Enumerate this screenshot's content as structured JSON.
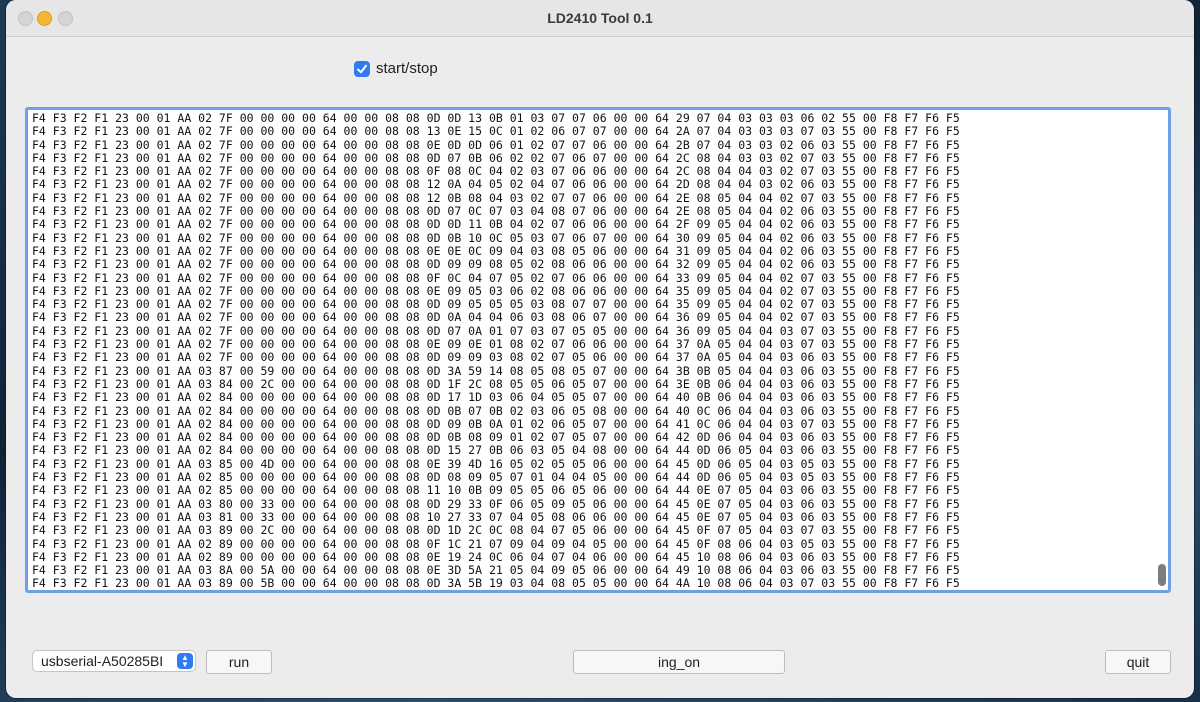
{
  "window": {
    "title": "LD2410 Tool 0.1"
  },
  "controls": {
    "start_stop_label": "start/stop",
    "start_stop_checked": true,
    "port_value": "usbserial-A50285BI",
    "run_label": "run",
    "ing_label": "ing_on",
    "quit_label": "quit"
  },
  "log_lines": [
    "F4 F3 F2 F1 23 00 01 AA 02 7F 00 00 00 00 64 00 00 08 08 0D 0D 13 0B 01 03 07 07 06 00 00 64 29 07 04 03 03 03 06 02 55 00 F8 F7 F6 F5",
    "F4 F3 F2 F1 23 00 01 AA 02 7F 00 00 00 00 64 00 00 08 08 13 0E 15 0C 01 02 06 07 07 00 00 64 2A 07 04 03 03 03 07 03 55 00 F8 F7 F6 F5",
    "F4 F3 F2 F1 23 00 01 AA 02 7F 00 00 00 00 64 00 00 08 08 0E 0D 0D 06 01 02 07 07 06 00 00 64 2B 07 04 03 03 02 06 03 55 00 F8 F7 F6 F5",
    "F4 F3 F2 F1 23 00 01 AA 02 7F 00 00 00 00 64 00 00 08 08 0D 07 0B 06 02 02 07 06 07 00 00 64 2C 08 04 03 03 02 07 03 55 00 F8 F7 F6 F5",
    "F4 F3 F2 F1 23 00 01 AA 02 7F 00 00 00 00 64 00 00 08 08 0F 08 0C 04 02 03 07 06 06 00 00 64 2C 08 04 04 03 02 07 03 55 00 F8 F7 F6 F5",
    "F4 F3 F2 F1 23 00 01 AA 02 7F 00 00 00 00 64 00 00 08 08 12 0A 04 05 02 04 07 06 06 00 00 64 2D 08 04 04 03 02 06 03 55 00 F8 F7 F6 F5",
    "F4 F3 F2 F1 23 00 01 AA 02 7F 00 00 00 00 64 00 00 08 08 12 0B 08 04 03 02 07 07 06 00 00 64 2E 08 05 04 04 02 07 03 55 00 F8 F7 F6 F5",
    "F4 F3 F2 F1 23 00 01 AA 02 7F 00 00 00 00 64 00 00 08 08 0D 07 0C 07 03 04 08 07 06 00 00 64 2E 08 05 04 04 02 06 03 55 00 F8 F7 F6 F5",
    "F4 F3 F2 F1 23 00 01 AA 02 7F 00 00 00 00 64 00 00 08 08 0D 0D 11 0B 04 02 07 06 06 00 00 64 2F 09 05 04 04 02 06 03 55 00 F8 F7 F6 F5",
    "F4 F3 F2 F1 23 00 01 AA 02 7F 00 00 00 00 64 00 00 08 08 0D 0B 10 0C 05 03 07 06 07 00 00 64 30 09 05 04 04 02 06 03 55 00 F8 F7 F6 F5",
    "F4 F3 F2 F1 23 00 01 AA 02 7F 00 00 00 00 64 00 00 08 08 0E 0E 0C 09 04 03 08 05 06 00 00 64 31 09 05 04 04 02 06 03 55 00 F8 F7 F6 F5",
    "F4 F3 F2 F1 23 00 01 AA 02 7F 00 00 00 00 64 00 00 08 08 0D 09 09 08 05 02 08 06 06 00 00 64 32 09 05 04 04 02 06 03 55 00 F8 F7 F6 F5",
    "F4 F3 F2 F1 23 00 01 AA 02 7F 00 00 00 00 64 00 00 08 08 0F 0C 04 07 05 02 07 06 06 00 00 64 33 09 05 04 04 02 07 03 55 00 F8 F7 F6 F5",
    "F4 F3 F2 F1 23 00 01 AA 02 7F 00 00 00 00 64 00 00 08 08 0E 09 05 03 06 02 08 06 06 00 00 64 35 09 05 04 04 02 07 03 55 00 F8 F7 F6 F5",
    "F4 F3 F2 F1 23 00 01 AA 02 7F 00 00 00 00 64 00 00 08 08 0D 09 05 05 05 03 08 07 07 00 00 64 35 09 05 04 04 02 07 03 55 00 F8 F7 F6 F5",
    "F4 F3 F2 F1 23 00 01 AA 02 7F 00 00 00 00 64 00 00 08 08 0D 0A 04 04 06 03 08 06 07 00 00 64 36 09 05 04 04 02 07 03 55 00 F8 F7 F6 F5",
    "F4 F3 F2 F1 23 00 01 AA 02 7F 00 00 00 00 64 00 00 08 08 0D 07 0A 01 07 03 07 05 05 00 00 64 36 09 05 04 04 03 07 03 55 00 F8 F7 F6 F5",
    "F4 F3 F2 F1 23 00 01 AA 02 7F 00 00 00 00 64 00 00 08 08 0E 09 0E 01 08 02 07 06 06 00 00 64 37 0A 05 04 04 03 07 03 55 00 F8 F7 F6 F5",
    "F4 F3 F2 F1 23 00 01 AA 02 7F 00 00 00 00 64 00 00 08 08 0D 09 09 03 08 02 07 05 06 00 00 64 37 0A 05 04 04 03 06 03 55 00 F8 F7 F6 F5",
    "F4 F3 F2 F1 23 00 01 AA 03 87 00 59 00 00 64 00 00 08 08 0D 3A 59 14 08 05 08 05 07 00 00 64 3B 0B 05 04 04 03 06 03 55 00 F8 F7 F6 F5",
    "F4 F3 F2 F1 23 00 01 AA 03 84 00 2C 00 00 64 00 00 08 08 0D 1F 2C 08 05 05 06 05 07 00 00 64 3E 0B 06 04 04 03 06 03 55 00 F8 F7 F6 F5",
    "F4 F3 F2 F1 23 00 01 AA 02 84 00 00 00 00 64 00 00 08 08 0D 17 1D 03 06 04 05 05 07 00 00 64 40 0B 06 04 04 03 06 03 55 00 F8 F7 F6 F5",
    "F4 F3 F2 F1 23 00 01 AA 02 84 00 00 00 00 64 00 00 08 08 0D 0B 07 0B 02 03 06 05 08 00 00 64 40 0C 06 04 04 03 06 03 55 00 F8 F7 F6 F5",
    "F4 F3 F2 F1 23 00 01 AA 02 84 00 00 00 00 64 00 00 08 08 0D 09 0B 0A 01 02 06 05 07 00 00 64 41 0C 06 04 04 03 07 03 55 00 F8 F7 F6 F5",
    "F4 F3 F2 F1 23 00 01 AA 02 84 00 00 00 00 64 00 00 08 08 0D 0B 08 09 01 02 07 05 07 00 00 64 42 0D 06 04 04 03 06 03 55 00 F8 F7 F6 F5",
    "F4 F3 F2 F1 23 00 01 AA 02 84 00 00 00 00 64 00 00 08 08 0D 15 27 0B 06 03 05 04 08 00 00 64 44 0D 06 05 04 03 06 03 55 00 F8 F7 F6 F5",
    "F4 F3 F2 F1 23 00 01 AA 03 85 00 4D 00 00 64 00 00 08 08 0E 39 4D 16 05 02 05 05 06 00 00 64 45 0D 06 05 04 03 05 03 55 00 F8 F7 F6 F5",
    "F4 F3 F2 F1 23 00 01 AA 02 85 00 00 00 00 64 00 00 08 08 0D 08 09 05 07 01 04 04 05 00 00 64 44 0D 06 05 04 03 05 03 55 00 F8 F7 F6 F5",
    "F4 F3 F2 F1 23 00 01 AA 02 85 00 00 00 00 64 00 00 08 08 11 10 0B 09 05 05 06 05 06 00 00 64 44 0E 07 05 04 03 06 03 55 00 F8 F7 F6 F5",
    "F4 F3 F2 F1 23 00 01 AA 03 80 00 33 00 00 64 00 00 08 08 0D 29 33 0F 06 05 09 05 06 00 00 64 45 0E 07 05 04 03 06 03 55 00 F8 F7 F6 F5",
    "F4 F3 F2 F1 23 00 01 AA 03 81 00 33 00 00 64 00 00 08 08 10 27 33 07 04 05 08 06 06 00 00 64 45 0E 07 05 04 03 06 03 55 00 F8 F7 F6 F5",
    "F4 F3 F2 F1 23 00 01 AA 03 89 00 2C 00 00 64 00 00 08 08 0D 1D 2C 0C 08 04 07 05 06 00 00 64 45 0F 07 05 04 03 07 03 55 00 F8 F7 F6 F5",
    "F4 F3 F2 F1 23 00 01 AA 02 89 00 00 00 00 64 00 00 08 08 0F 1C 21 07 09 04 09 04 05 00 00 64 45 0F 08 06 04 03 05 03 55 00 F8 F7 F6 F5",
    "F4 F3 F2 F1 23 00 01 AA 02 89 00 00 00 00 64 00 00 08 08 0E 19 24 0C 06 04 07 04 06 00 00 64 45 10 08 06 04 03 06 03 55 00 F8 F7 F6 F5",
    "F4 F3 F2 F1 23 00 01 AA 03 8A 00 5A 00 00 64 00 00 08 08 0E 3D 5A 21 05 04 09 05 06 00 00 64 49 10 08 06 04 03 06 03 55 00 F8 F7 F6 F5",
    "F4 F3 F2 F1 23 00 01 AA 03 89 00 5B 00 00 64 00 00 08 08 0D 3A 5B 19 03 04 08 05 05 00 00 64 4A 10 08 06 04 03 07 03 55 00 F8 F7 F6 F5"
  ]
}
